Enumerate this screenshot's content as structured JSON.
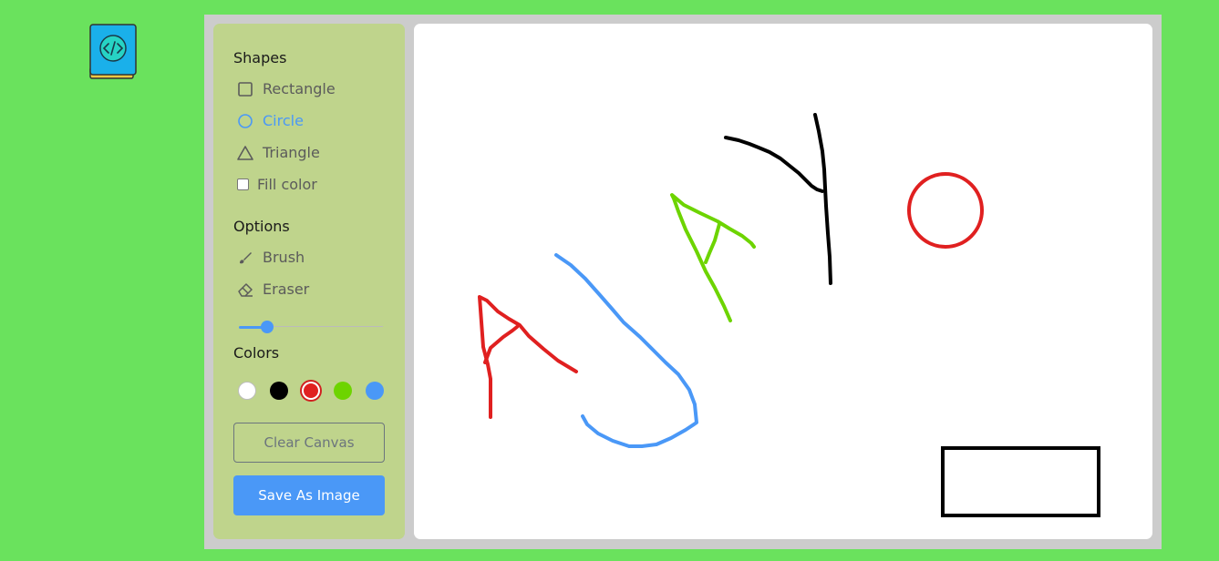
{
  "sections": {
    "shapes": "Shapes",
    "options": "Options",
    "colors": "Colors"
  },
  "shapes": [
    {
      "label": "Rectangle",
      "icon": "square-icon",
      "active": false
    },
    {
      "label": "Circle",
      "icon": "circle-icon",
      "active": true
    },
    {
      "label": "Triangle",
      "icon": "triangle-icon",
      "active": false
    }
  ],
  "fill_color": {
    "label": "Fill color",
    "checked": false
  },
  "options": [
    {
      "label": "Brush",
      "icon": "brush-icon"
    },
    {
      "label": "Eraser",
      "icon": "eraser-icon"
    }
  ],
  "brush_size_fraction": 0.17,
  "color_swatches": [
    {
      "name": "white",
      "hex": "#ffffff",
      "selected": false
    },
    {
      "name": "black",
      "hex": "#000000",
      "selected": false
    },
    {
      "name": "red",
      "hex": "#e02020",
      "selected": true
    },
    {
      "name": "green",
      "hex": "#6dd400",
      "selected": false
    },
    {
      "name": "blue",
      "hex": "#4a98f7",
      "selected": false
    }
  ],
  "buttons": {
    "clear": "Clear Canvas",
    "save": "Save As Image"
  },
  "theme": {
    "background": "#6ae25d",
    "panel": "#bfd48c",
    "accent": "#4a98f7"
  }
}
